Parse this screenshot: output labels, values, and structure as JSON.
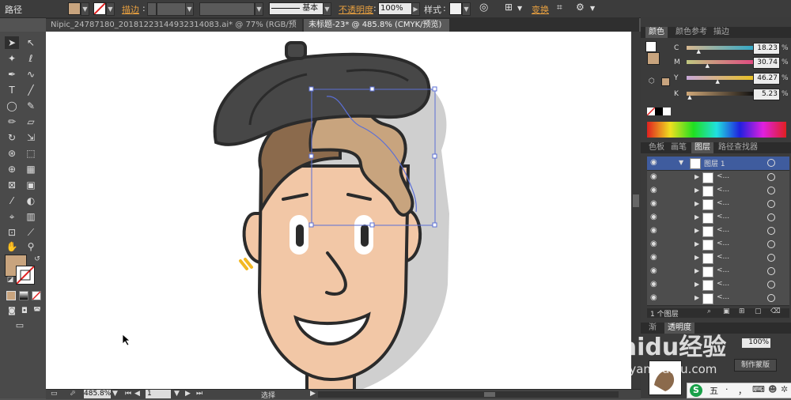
{
  "control_bar": {
    "mode_label": "路径",
    "stroke_label": "描边",
    "stroke_colon": ":",
    "brush_label": "基本",
    "opacity_label": "不透明度",
    "opacity_colon": ":",
    "opacity_value": "100%",
    "style_label": "样式",
    "style_colon": ":",
    "transform_label": "变换",
    "fill_color": "#c8a47e"
  },
  "tabs": [
    {
      "label": "Nipic_24787180_20181223144932314083.ai* @ 77% (RGB/预览)",
      "close": "×"
    },
    {
      "label": "未标题-23* @ 485.8% (CMYK/预览)",
      "close": "×"
    }
  ],
  "status": {
    "zoom": "485.8%",
    "page": "1",
    "tool": "选择"
  },
  "color_panel": {
    "tabs": [
      "颜色",
      "颜色参考",
      "描边"
    ],
    "channels": [
      {
        "label": "C",
        "value": "18.23",
        "pos": 0.18,
        "grad": "linear-gradient(to right,#d8b890,#2fa8c8)"
      },
      {
        "label": "M",
        "value": "30.74",
        "pos": 0.31,
        "grad": "linear-gradient(to right,#c0c880,#e04880)"
      },
      {
        "label": "Y",
        "value": "46.27",
        "pos": 0.46,
        "grad": "linear-gradient(to right,#c8a8d8,#e8c020)"
      },
      {
        "label": "K",
        "value": "5.23",
        "pos": 0.05,
        "grad": "linear-gradient(to right,#d0a878,#101010)"
      }
    ],
    "percent": "%"
  },
  "layers_panel": {
    "tabs": [
      "色板",
      "画笔",
      "图层",
      "路径查找器"
    ],
    "top_layer": "图层 1",
    "sublayer_label": "<...",
    "sublayer_count": 10,
    "footer": "1 个图层"
  },
  "bottom_panel": {
    "tabs": [
      "渐",
      "透明度"
    ],
    "opacity": "100%",
    "mask_button": "制作蒙版"
  },
  "watermark": {
    "brand": "Baidu经验",
    "url": "jingyan.baidu.com"
  },
  "ime": {
    "labels": [
      "五",
      "·",
      "，",
      "⌨"
    ]
  }
}
